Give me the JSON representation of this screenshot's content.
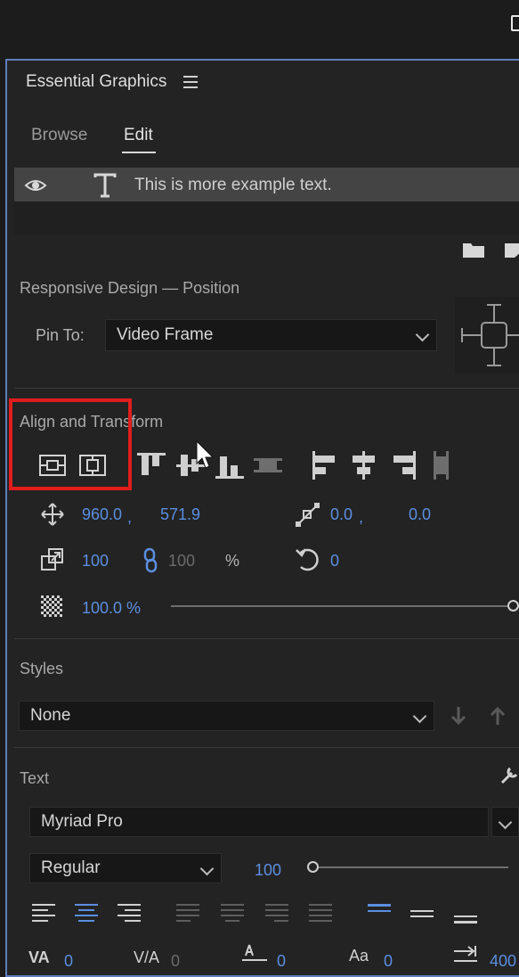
{
  "panel": {
    "title": "Essential Graphics",
    "tabs": [
      {
        "label": "Browse",
        "active": false
      },
      {
        "label": "Edit",
        "active": true
      }
    ]
  },
  "layer": {
    "text": "This is more example text."
  },
  "responsive": {
    "heading": "Responsive Design — Position",
    "pin_label": "Pin To:",
    "pin_value": "Video Frame"
  },
  "align": {
    "heading": "Align and Transform",
    "position_x": "960.0",
    "position_sep": ",",
    "position_y": "571.9",
    "anchor_x": "0.0",
    "anchor_sep": ",",
    "anchor_y": "0.0",
    "scale": "100",
    "scale_linked": "100",
    "scale_unit": "%",
    "rotation": "0",
    "opacity": "100.0 %",
    "opacity_fraction": 1.0
  },
  "styles": {
    "heading": "Styles",
    "value": "None"
  },
  "text": {
    "heading": "Text",
    "font": "Myriad Pro",
    "weight": "Regular",
    "size": "100",
    "bottom_values": [
      "0",
      "0",
      "0",
      "0",
      "400"
    ]
  },
  "colors": {
    "accent_blue": "#5b8fe0",
    "highlight_red": "#e01d1d",
    "panel_border": "#5f7dbd"
  }
}
